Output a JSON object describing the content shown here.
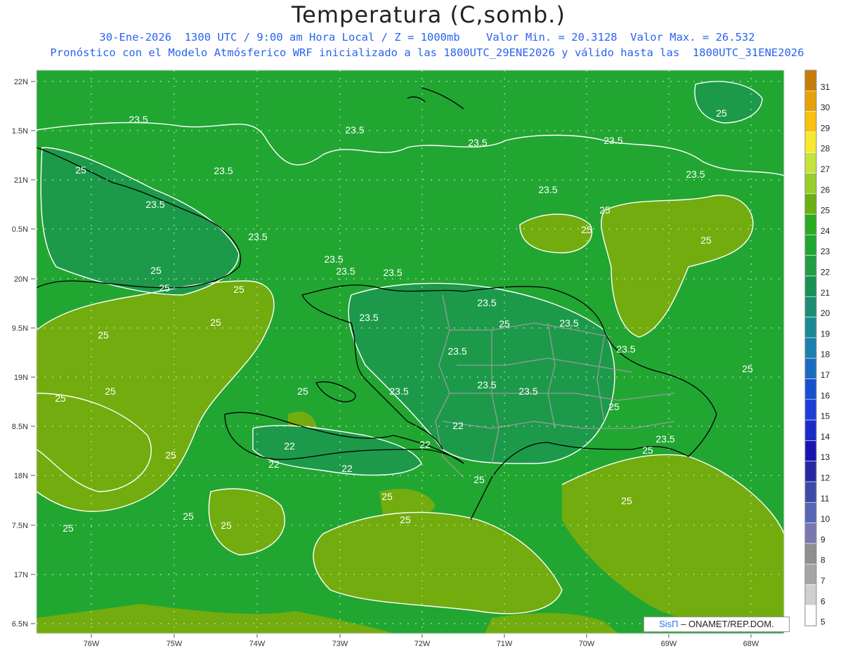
{
  "title": "Temperatura (C,somb.)",
  "subtitle_line1": "30-Ene-2026  1300 UTC / 9:00 am Hora Local / Z = 1000mb    Valor Min. = 20.3128  Valor Max. = 26.532",
  "subtitle_line2": "Pronóstico con el Modelo Atmósferico WRF inicializado a las 1800UTC_29ENE2026 y válido hasta las  1800UTC_31ENE2026",
  "credit": {
    "brand": "SisΠ",
    "text": "– ONAMET/REP.DOM."
  },
  "colors": {
    "base_green": "#21a632",
    "warm_olive": "#73ac0e",
    "cool_teal": "#1c9a4a",
    "contour": "#ffffff",
    "coastline": "#000000",
    "border": "#9a9a9a"
  },
  "lat_labels": [
    "22N",
    "1.5N",
    "21N",
    "0.5N",
    "20N",
    "9.5N",
    "19N",
    "8.5N",
    "18N",
    "7.5N",
    "17N",
    "6.5N"
  ],
  "lon_labels": [
    "76W",
    "75W",
    "74W",
    "73W",
    "72W",
    "71W",
    "70W",
    "69W",
    "68W"
  ],
  "colorbar": {
    "labels": [
      "31",
      "30",
      "29",
      "28",
      "27",
      "26",
      "25",
      "24",
      "23",
      "22",
      "21",
      "20",
      "19",
      "18",
      "17",
      "16",
      "15",
      "14",
      "13",
      "12",
      "11",
      "10",
      "9",
      "8",
      "7",
      "6",
      "5"
    ],
    "colors": [
      "#c97c08",
      "#e8a106",
      "#fbbf10",
      "#f7ea2e",
      "#c6e43a",
      "#98cd2a",
      "#6bb012",
      "#2aab22",
      "#1ea830",
      "#239d45",
      "#179255",
      "#1d8d73",
      "#198a95",
      "#1b7fb0",
      "#1a6cc3",
      "#1650cf",
      "#1b3ed8",
      "#1a2bc9",
      "#1715b0",
      "#2528a2",
      "#3f4aa8",
      "#5765b4",
      "#7b78b0",
      "#8f8f8f",
      "#a5a5a5",
      "#cfcfcf",
      "#ffffff"
    ]
  },
  "contour_labels": [
    {
      "text": "23.5"
    },
    {
      "text": "23.5"
    },
    {
      "text": "23.5"
    },
    {
      "text": "23.5"
    },
    {
      "text": "23.5"
    },
    {
      "text": "23.5"
    },
    {
      "text": "23.5"
    },
    {
      "text": "23.5"
    },
    {
      "text": "23.5"
    },
    {
      "text": "23.5"
    },
    {
      "text": "23.5"
    },
    {
      "text": "23.5"
    },
    {
      "text": "23.5"
    },
    {
      "text": "23.5"
    },
    {
      "text": "23.5"
    },
    {
      "text": "23.5"
    },
    {
      "text": "23.5"
    },
    {
      "text": "23.5"
    },
    {
      "text": "23.5"
    },
    {
      "text": "23.5"
    },
    {
      "text": "23.5"
    },
    {
      "text": "22"
    },
    {
      "text": "22"
    },
    {
      "text": "22"
    },
    {
      "text": "22"
    },
    {
      "text": "22"
    },
    {
      "text": "25"
    },
    {
      "text": "25"
    },
    {
      "text": "25"
    },
    {
      "text": "25"
    },
    {
      "text": "25"
    },
    {
      "text": "25"
    },
    {
      "text": "25"
    },
    {
      "text": "25"
    },
    {
      "text": "25"
    },
    {
      "text": "25"
    },
    {
      "text": "25"
    },
    {
      "text": "25"
    },
    {
      "text": "25"
    },
    {
      "text": "25"
    },
    {
      "text": "25"
    },
    {
      "text": "25"
    },
    {
      "text": "25"
    },
    {
      "text": "25"
    },
    {
      "text": "25"
    },
    {
      "text": "25"
    },
    {
      "text": "25"
    },
    {
      "text": "25"
    },
    {
      "text": "25"
    },
    {
      "text": "25"
    },
    {
      "text": "25"
    }
  ]
}
